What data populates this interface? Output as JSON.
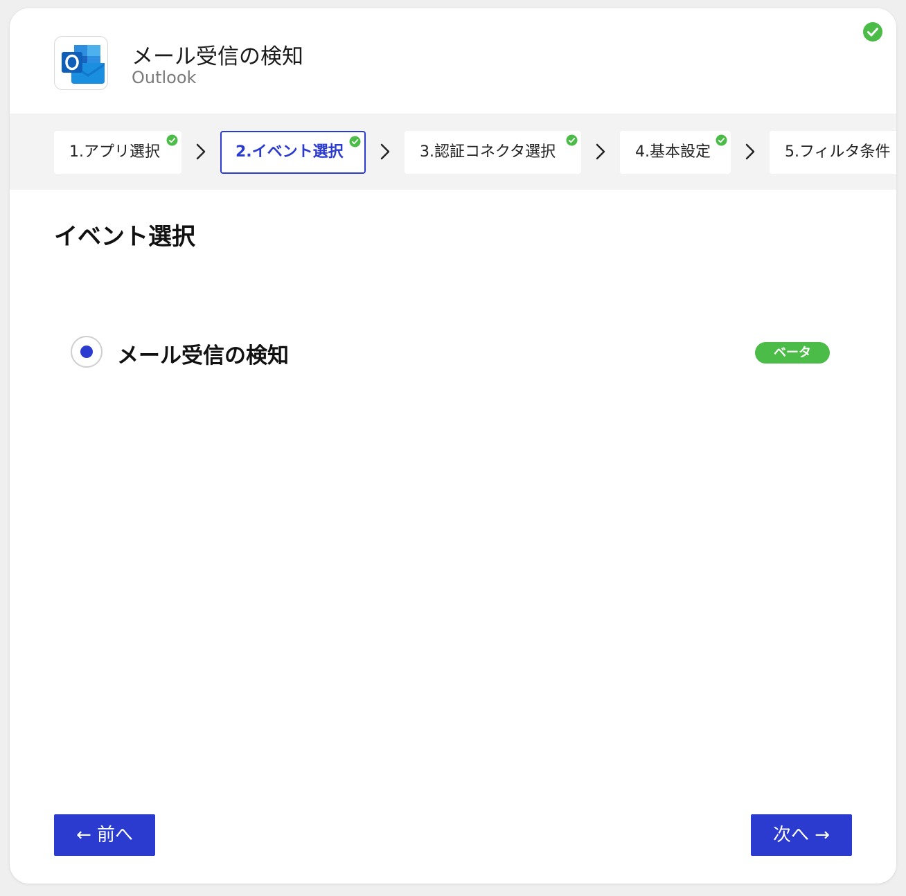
{
  "header": {
    "title": "メール受信の検知",
    "subtitle": "Outlook",
    "logo_icon": "outlook-logo-icon",
    "status_icon": "check-circle-icon"
  },
  "colors": {
    "accent": "#2b3bd0",
    "success": "#4cbc48",
    "stepper_bg": "#f3f3f3"
  },
  "steps": [
    {
      "label": "1.アプリ選択",
      "completed": true,
      "active": false
    },
    {
      "label": "2.イベント選択",
      "completed": true,
      "active": true
    },
    {
      "label": "3.認証コネクタ選択",
      "completed": true,
      "active": false
    },
    {
      "label": "4.基本設定",
      "completed": true,
      "active": false
    },
    {
      "label": "5.フィルタ条件",
      "completed": false,
      "active": false
    }
  ],
  "section": {
    "title": "イベント選択"
  },
  "option": {
    "label": "メール受信の検知",
    "selected": true,
    "badge": "ベータ"
  },
  "footer": {
    "prev_label": "← 前へ",
    "next_label": "次へ →"
  }
}
